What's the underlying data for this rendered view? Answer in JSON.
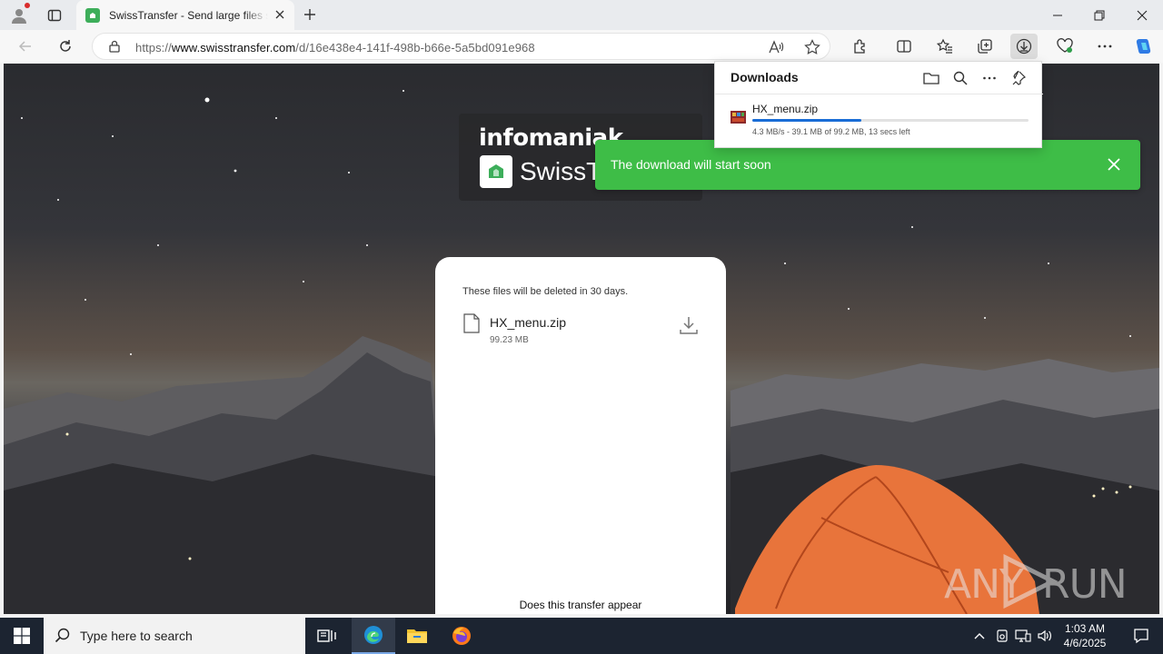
{
  "browser": {
    "tab_title": "SwissTransfer - Send large files se",
    "url_prefix": "https://",
    "url_host": "www.swisstransfer.com",
    "url_path": "/d/16e438e4-141f-498b-b66e-5a5bd091e968"
  },
  "page": {
    "logo_word": "infomaniak",
    "logo_name": "SwissT",
    "delete_note": "These files will be deleted in 30 days.",
    "file_name": "HX_menu.zip",
    "file_size": "99.23 MB",
    "appear_text": "Does this transfer appear",
    "toast_text": "The download will start soon",
    "watermark": "ANY RUN"
  },
  "downloads": {
    "title": "Downloads",
    "item_name": "HX_menu.zip",
    "item_status": "4.3 MB/s - 39.1 MB of 99.2 MB, 13 secs left",
    "progress_fraction": 0.394
  },
  "taskbar": {
    "search_placeholder": "Type here to search",
    "time": "1:03 AM",
    "date": "4/6/2025"
  },
  "colors": {
    "toast": "#3ebd47",
    "progress": "#1a6dd6",
    "taskbar": "#1c2431",
    "brand": "#3dae5a"
  }
}
